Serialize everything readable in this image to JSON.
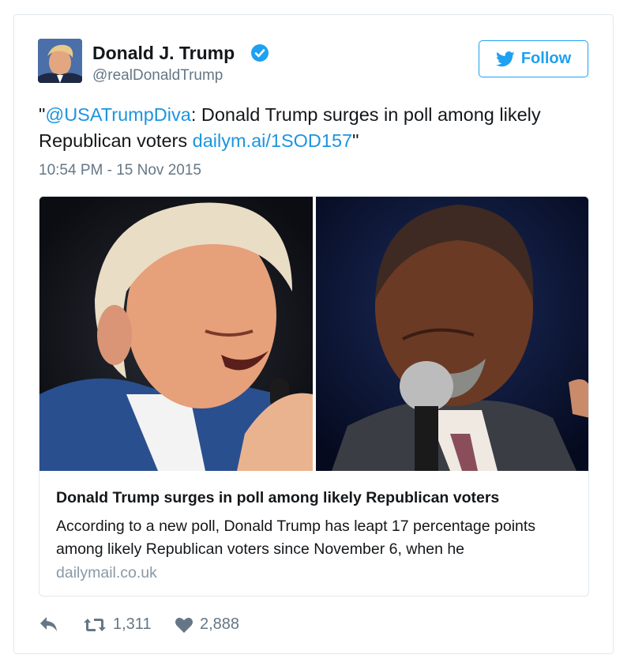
{
  "author": {
    "name": "Donald J. Trump",
    "handle": "@realDonaldTrump",
    "avatar_icon": "profile-photo",
    "verified_icon": "verified-badge-icon"
  },
  "follow_button": {
    "label": "Follow",
    "icon": "twitter-bird-icon"
  },
  "tweet": {
    "quote_open": "\"",
    "mention": "@USATrumpDiva",
    "text": ": Donald Trump surges in poll among likely Republican voters ",
    "link": "dailym.ai/1SOD157",
    "quote_close": "\"",
    "timestamp": "10:54 PM - 15 Nov 2015"
  },
  "link_card": {
    "title": "Donald Trump surges in poll among likely Republican voters",
    "description": "According to a new poll, Donald Trump has leapt 17 percentage points among likely Republican voters since November 6, when he",
    "domain": "dailymail.co.uk"
  },
  "actions": {
    "reply_icon": "reply-icon",
    "retweet_icon": "retweet-icon",
    "retweet_count": "1,311",
    "like_icon": "heart-icon",
    "like_count": "2,888"
  },
  "colors": {
    "link": "#1b95e0",
    "follow": "#1da1f2",
    "text": "#14171a",
    "secondary": "#657786",
    "border": "#e1e8ed"
  }
}
